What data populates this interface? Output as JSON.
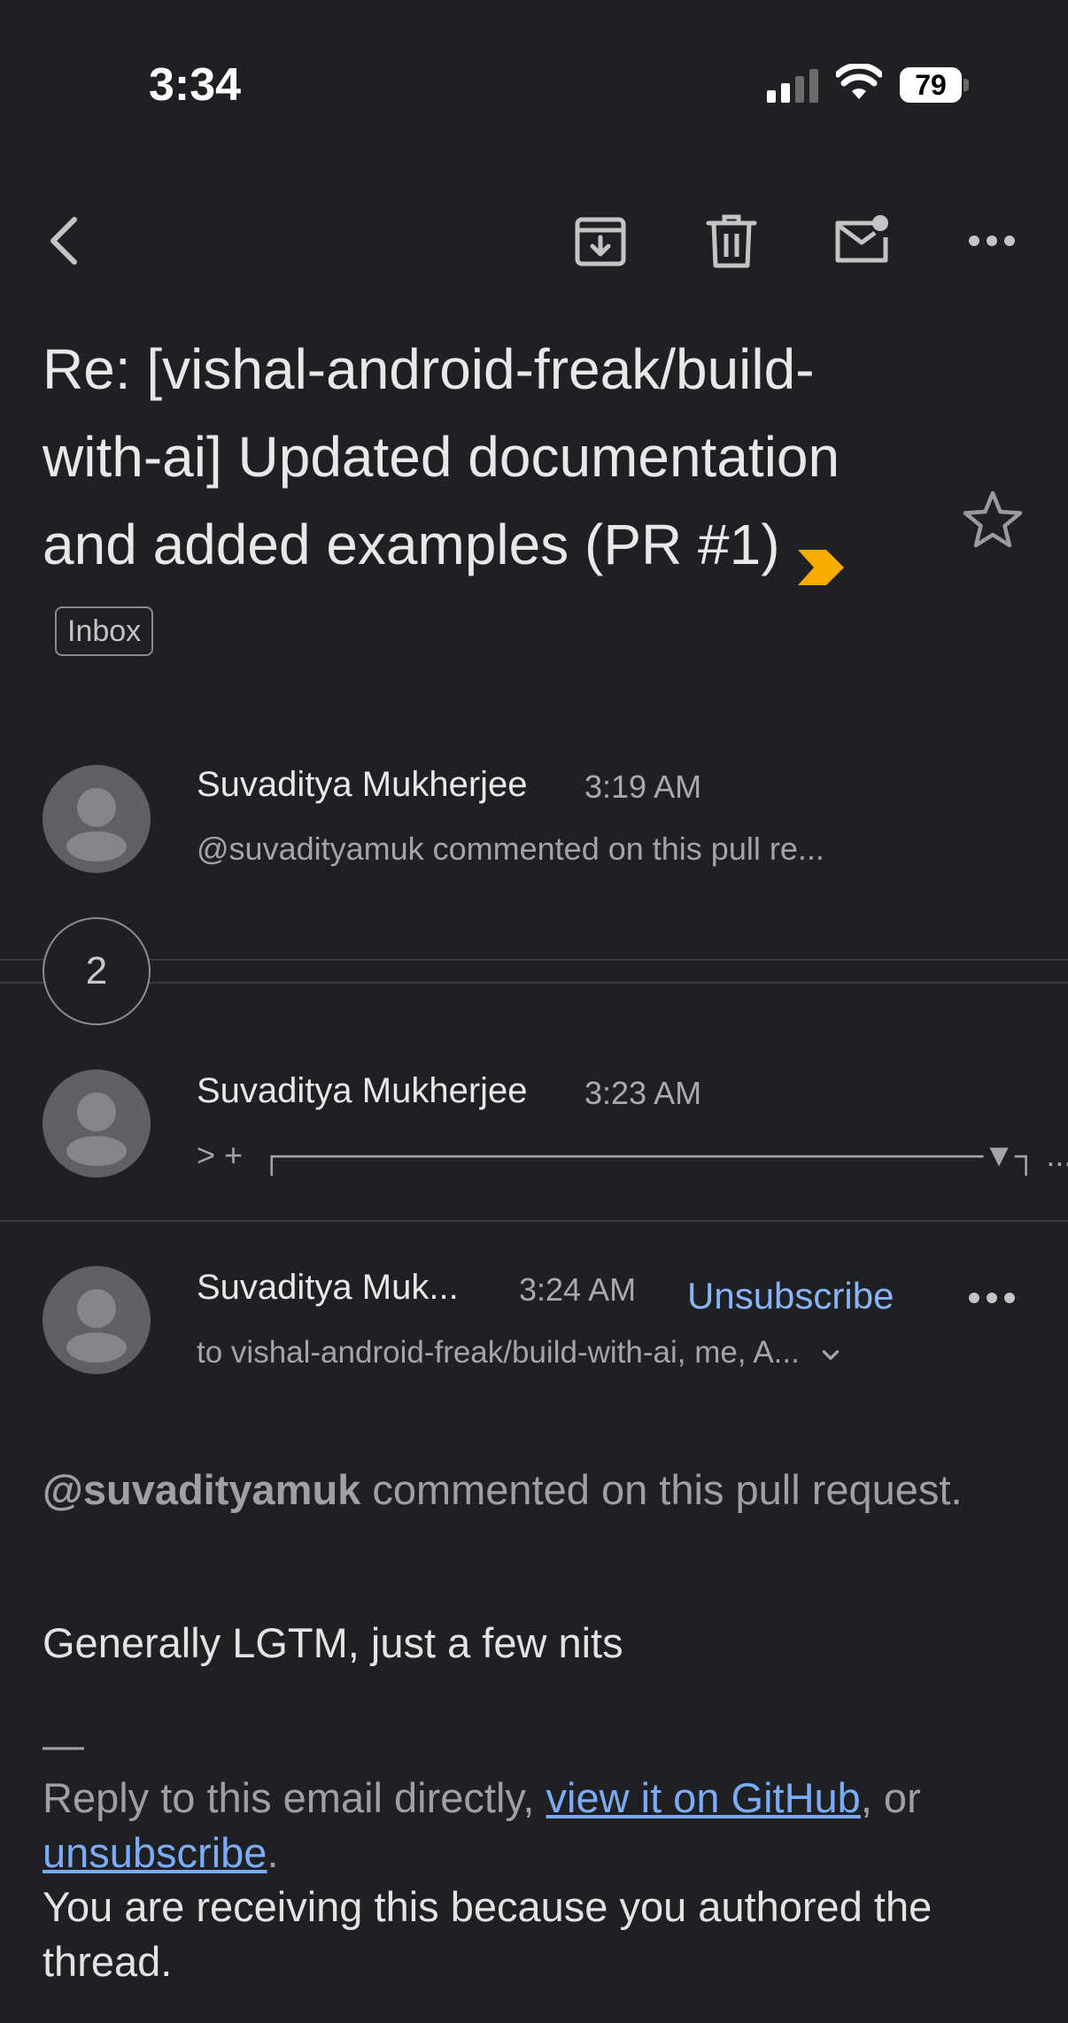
{
  "status_bar": {
    "time": "3:34",
    "battery": "79"
  },
  "toolbar": {
    "back_icon": "chevron-left-icon",
    "archive_icon": "archive-icon",
    "delete_icon": "trash-icon",
    "mark_unread_icon": "mail-unread-icon",
    "more_icon": "more-horizontal-icon"
  },
  "subject": {
    "title": "Re: [vishal-android-freak/build-with-ai] Updated documentation and added examples (PR #1)",
    "label": "Inbox",
    "importance_color": "#f9ab00"
  },
  "messages": [
    {
      "sender": "Suvaditya Mukherjee",
      "time": "3:19 AM",
      "snippet": "@suvadityamuk commented on this pull re..."
    },
    {
      "sender": "Suvaditya Mukherjee",
      "time": "3:23 AM",
      "snippet": "> +  ┌───────────────────────────────▼┐ ..."
    },
    {
      "sender": "Suvaditya Muk...",
      "time": "3:24 AM",
      "recipients": "to vishal-android-freak/build-with-ai, me, A...",
      "unsubscribe": "Unsubscribe"
    }
  ],
  "collapsed_count": "2",
  "body": {
    "mention": "@suvadityamuk",
    "mention_rest": " commented on this pull request.",
    "comment": "Generally LGTM, just a few nits",
    "separator": "—",
    "reply_prefix": "Reply to this email directly, ",
    "github_link": "view it on GitHub",
    "reply_mid": ", or ",
    "unsubscribe_link": "unsubscribe",
    "reply_end": ".",
    "footer": "You are receiving this because you authored the thread."
  },
  "colors": {
    "background": "#1f2023",
    "accent": "#8ab4f8",
    "link": "#7cacf8"
  }
}
